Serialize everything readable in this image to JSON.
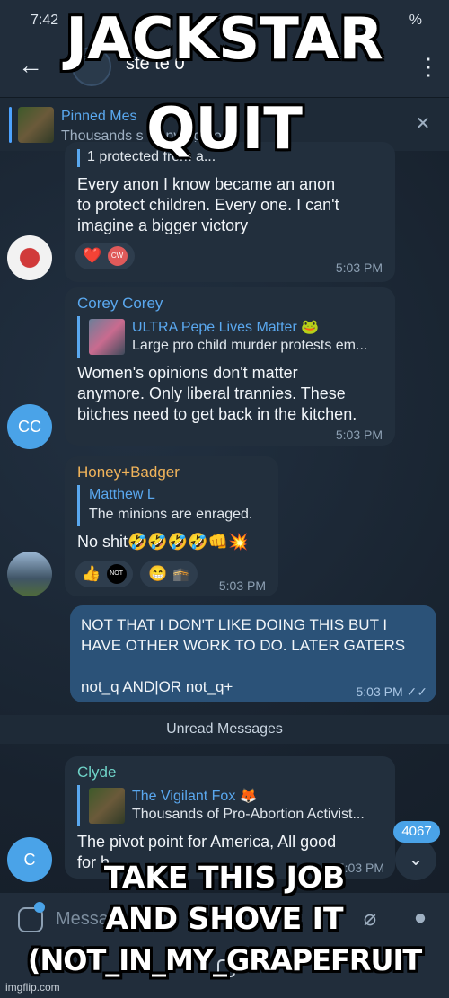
{
  "status_bar": {
    "time": "7:42",
    "battery": "%"
  },
  "header": {
    "title": "ste        te  0"
  },
  "pinned": {
    "title": "Pinned Mes",
    "text": "Thousands              s Converge o..."
  },
  "messages": [
    {
      "reply_text": "1                      protected from a...",
      "text_lines": [
        "Every anon I know became an anon",
        "to protect children. Every one. I can't",
        "imagine a bigger victory"
      ],
      "reactions": [
        "❤️",
        "CW"
      ],
      "time": "5:03 PM"
    },
    {
      "sender": "Corey Corey",
      "reply_name": "ULTRA Pepe Lives Matter 🐸",
      "reply_text": "Large pro child murder protests em...",
      "text_lines": [
        "Women's opinions don't matter",
        "anymore. Only liberal trannies. These",
        "bitches need to get back in the kitchen."
      ],
      "time": "5:03 PM",
      "avatar": "CC"
    },
    {
      "sender": "Honey+Badger",
      "reply_name": "Matthew L",
      "reply_text": "The minions are enraged.",
      "text_lines": [
        "No shit🤣🤣🤣🤣👊💥"
      ],
      "reactions": [
        "👍",
        "NOT",
        "😁",
        "🕋"
      ],
      "time": "5:03 PM"
    },
    {
      "text_lines": [
        "NOT THAT I DON'T LIKE DOING THIS BUT I",
        "HAVE OTHER WORK TO DO. LATER GATERS",
        "",
        "not_q AND|OR not_q+"
      ],
      "time": "5:03 PM ✓✓"
    },
    {
      "sender": "Clyde",
      "reply_name": "The Vigilant Fox 🦊",
      "reply_text": "Thousands of Pro-Abortion Activist...",
      "text_lines": [
        "The pivot point for America, All good",
        "for h"
      ],
      "time": "5:03 PM",
      "avatar": "C"
    }
  ],
  "unread_label": "Unread Messages",
  "scroll_badge": "4067",
  "input": {
    "placeholder": "Messa"
  },
  "meme": {
    "top_line1": "JACKSTAR",
    "top_line2": "QUIT",
    "bottom_line1": "TAKE THIS JOB",
    "bottom_line2": "AND SHOVE IT",
    "bottom_line3": "(NOT_IN_MY_GRAPEFRUIT"
  },
  "watermark": "imgflip.com",
  "colors": {
    "accent": "#4aa3e8",
    "outgoing_bubble": "#2b5278",
    "incoming_bubble": "#222f3d",
    "link": "#5aa8ef",
    "honey_badger": "#f0b35a",
    "clyde": "#6fd3c8"
  }
}
